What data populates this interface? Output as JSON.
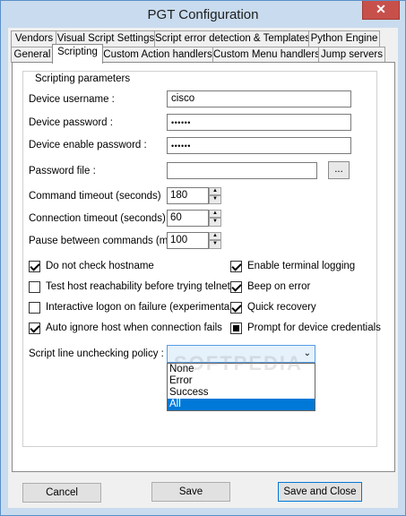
{
  "window": {
    "title": "PGT Configuration",
    "close_glyph": "✕"
  },
  "tabs_row1": [
    {
      "label": "Vendors"
    },
    {
      "label": "Visual Script Settings"
    },
    {
      "label": "Script error detection & Templates"
    },
    {
      "label": "Python Engine"
    }
  ],
  "tabs_row2": [
    {
      "label": "General"
    },
    {
      "label": "Scripting"
    },
    {
      "label": "Custom Action handlers"
    },
    {
      "label": "Custom Menu handlers"
    },
    {
      "label": "Jump servers"
    }
  ],
  "active_tab": "Scripting",
  "group": {
    "legend": "Scripting parameters"
  },
  "fields": {
    "device_username": {
      "label": "Device username :",
      "value": "cisco"
    },
    "device_password": {
      "label": "Device password :",
      "value": "••••••"
    },
    "device_enable_password": {
      "label": "Device enable password :",
      "value": "••••••"
    },
    "password_file": {
      "label": "Password file  :",
      "value": "",
      "browse_label": "..."
    }
  },
  "spinners": {
    "command_timeout": {
      "label": "Command timeout (seconds)",
      "value": "180"
    },
    "connection_timeout": {
      "label": "Connection timeout (seconds)",
      "value": "60"
    },
    "pause_between": {
      "label": "Pause between commands (ms)",
      "value": "100"
    }
  },
  "checkboxes": {
    "do_not_check_hostname": {
      "label": "Do not check hostname",
      "state": "checked"
    },
    "test_host_reachability": {
      "label": "Test host reachability before trying telnet",
      "state": "unchecked"
    },
    "interactive_logon": {
      "label": "Interactive logon on failure (experimental)",
      "state": "unchecked"
    },
    "auto_ignore_host": {
      "label": "Auto ignore host when connection fails",
      "state": "checked"
    },
    "enable_terminal_logging": {
      "label": "Enable terminal logging",
      "state": "checked"
    },
    "beep_on_error": {
      "label": "Beep on error",
      "state": "checked"
    },
    "quick_recovery": {
      "label": "Quick recovery",
      "state": "checked"
    },
    "prompt_device_credentials": {
      "label": "Prompt for device credentials",
      "state": "indeterminate"
    }
  },
  "unchecking_policy": {
    "label": "Script line unchecking policy :",
    "value": "",
    "options": [
      "None",
      "Error",
      "Success",
      "All"
    ],
    "highlighted": "All"
  },
  "watermark": "SOFTPEDIA",
  "buttons": {
    "cancel": "Cancel",
    "save": "Save",
    "save_and_close": "Save and Close"
  },
  "icons": {
    "spin_up": "▲",
    "spin_down": "▼",
    "combo_arrow": "⌄"
  }
}
